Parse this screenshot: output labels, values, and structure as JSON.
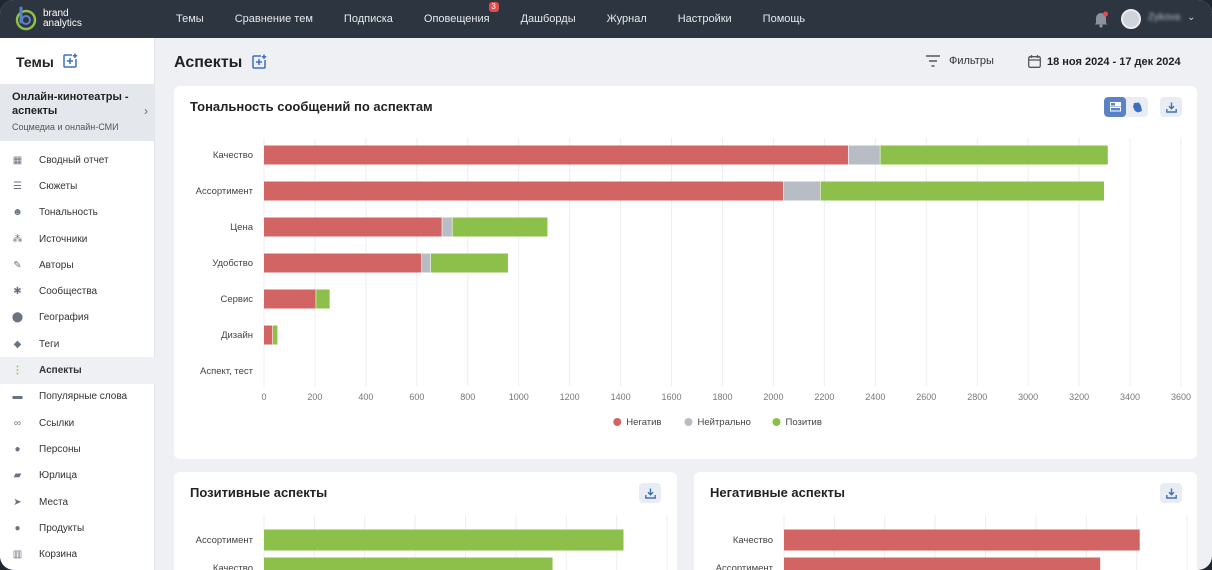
{
  "nav": {
    "logo_line1": "brand",
    "logo_line2": "analytics",
    "items": [
      "Темы",
      "Сравнение тем",
      "Подписка",
      "Оповещения",
      "Дашборды",
      "Журнал",
      "Настройки",
      "Помощь"
    ],
    "alerts_badge": "3",
    "user_name": "Zykova"
  },
  "sidebar": {
    "title": "Темы",
    "topic_name": "Онлайн-кинотеатры - аспекты",
    "topic_sources": "Соцмедиа и онлайн-СМИ",
    "items": [
      {
        "label": "Сводный отчет",
        "icon": "grid-icon"
      },
      {
        "label": "Сюжеты",
        "icon": "stories-icon"
      },
      {
        "label": "Тональность",
        "icon": "smile-icon"
      },
      {
        "label": "Источники",
        "icon": "sources-icon"
      },
      {
        "label": "Авторы",
        "icon": "pen-icon"
      },
      {
        "label": "Сообщества",
        "icon": "communities-icon"
      },
      {
        "label": "География",
        "icon": "location-pin-icon"
      },
      {
        "label": "Теги",
        "icon": "tag-icon"
      },
      {
        "label": "Аспекты",
        "icon": "aspects-icon"
      },
      {
        "label": "Популярные слова",
        "icon": "chat-bubble-icon"
      },
      {
        "label": "Ссылки",
        "icon": "link-icon"
      },
      {
        "label": "Персоны",
        "icon": "person-icon"
      },
      {
        "label": "Юрлица",
        "icon": "briefcase-icon"
      },
      {
        "label": "Места",
        "icon": "navigation-arrow-icon"
      },
      {
        "label": "Продукты",
        "icon": "apple-icon"
      },
      {
        "label": "Корзина",
        "icon": "trash-icon"
      }
    ],
    "active_index": 8
  },
  "header": {
    "title": "Аспекты",
    "filters_label": "Фильтры",
    "date_range": "18 ноя 2024 - 17 дек 2024"
  },
  "colors": {
    "negative": "#d36464",
    "neutral": "#b8bcc4",
    "positive": "#8cc04a"
  },
  "chart_data": [
    {
      "type": "bar",
      "orientation": "horizontal",
      "stacked": true,
      "title": "Тональность сообщений по аспектам",
      "categories": [
        "Качество",
        "Ассортимент",
        "Цена",
        "Удобство",
        "Сервис",
        "Дизайн",
        "Аспект, тест"
      ],
      "series": [
        {
          "name": "Негатив",
          "values": [
            2295,
            2040,
            700,
            620,
            205,
            35,
            0
          ]
        },
        {
          "name": "Нейтрально",
          "values": [
            125,
            145,
            40,
            35,
            0,
            0,
            0
          ]
        },
        {
          "name": "Позитив",
          "values": [
            895,
            1115,
            375,
            305,
            55,
            20,
            0
          ]
        }
      ],
      "xlim": [
        0,
        3600
      ],
      "xticks": [
        "0",
        "200",
        "400",
        "600",
        "800",
        "1000",
        "1200",
        "1400",
        "1600",
        "1800",
        "2000",
        "2200",
        "2400",
        "2600",
        "2800",
        "3000",
        "3200",
        "3400",
        "3600"
      ],
      "legend": "bottom",
      "grid": true
    },
    {
      "type": "bar",
      "orientation": "horizontal",
      "title": "Позитивные аспекты",
      "categories": [
        "Ассортимент",
        "Качество"
      ],
      "values": [
        1115,
        895
      ],
      "xlim": [
        0,
        1250
      ]
    },
    {
      "type": "bar",
      "orientation": "horizontal",
      "title": "Негативные аспекты",
      "categories": [
        "Качество",
        "Ассортимент"
      ],
      "values": [
        2295,
        2040
      ],
      "xlim": [
        0,
        2600
      ]
    }
  ]
}
